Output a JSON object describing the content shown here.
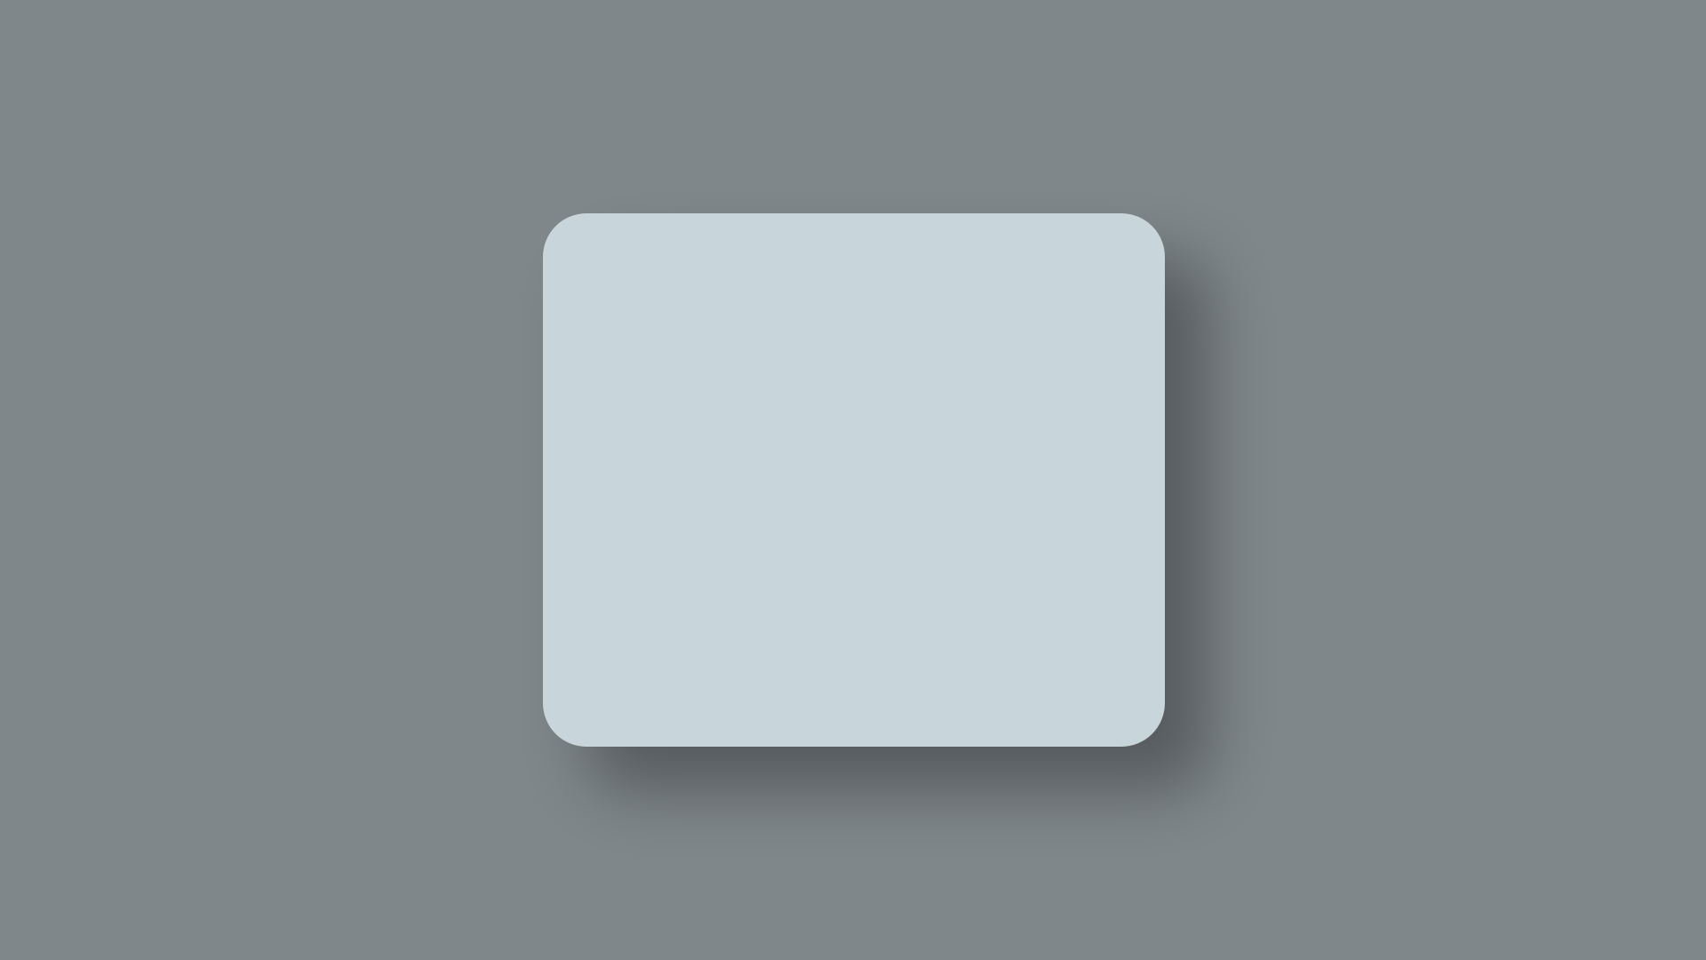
{
  "overlay": {
    "background_color": "#7F878B"
  },
  "dialog": {
    "background_color": "#C8D5DB"
  }
}
